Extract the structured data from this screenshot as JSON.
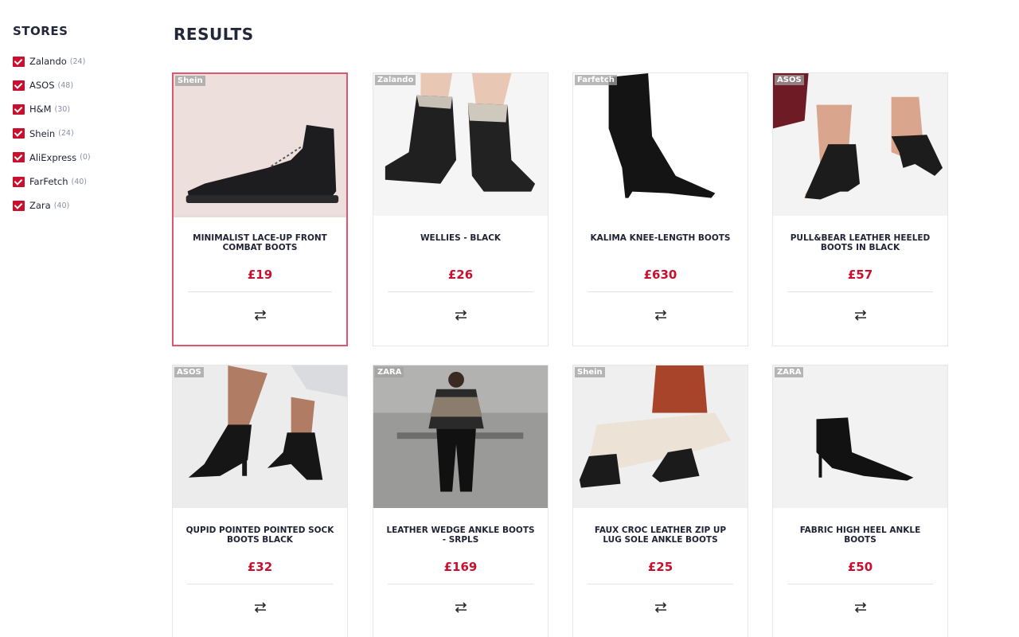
{
  "sidebar": {
    "title": "STORES",
    "stores": [
      {
        "name": "Zalando",
        "count": "(24)",
        "checked": true
      },
      {
        "name": "ASOS",
        "count": "(48)",
        "checked": true
      },
      {
        "name": "H&M",
        "count": "(30)",
        "checked": true
      },
      {
        "name": "Shein",
        "count": "(24)",
        "checked": true
      },
      {
        "name": "AliExpress",
        "count": "(0)",
        "checked": true
      },
      {
        "name": "FarFetch",
        "count": "(40)",
        "checked": true
      },
      {
        "name": "Zara",
        "count": "(40)",
        "checked": true
      }
    ]
  },
  "results": {
    "title": "RESULTS",
    "products": [
      {
        "store": "Shein",
        "title": "MINIMALIST LACE-UP FRONT COMBAT BOOTS",
        "price": "£19",
        "selected": true
      },
      {
        "store": "Zalando",
        "title": "WELLIES - BLACK",
        "price": "£26",
        "selected": false
      },
      {
        "store": "Farfetch",
        "title": "KALIMA KNEE-LENGTH BOOTS",
        "price": "£630",
        "selected": false
      },
      {
        "store": "ASOS",
        "title": "PULL&BEAR LEATHER HEELED BOOTS IN BLACK",
        "price": "£57",
        "selected": false
      },
      {
        "store": "ASOS",
        "title": "QUPID POINTED POINTED SOCK BOOTS BLACK",
        "price": "£32",
        "selected": false
      },
      {
        "store": "ZARA",
        "title": "LEATHER WEDGE ANKLE BOOTS - SRPLS",
        "price": "£169",
        "selected": false
      },
      {
        "store": "Shein",
        "title": "FAUX CROC LEATHER ZIP UP LUG SOLE ANKLE BOOTS",
        "price": "£25",
        "selected": false
      },
      {
        "store": "ZARA",
        "title": "FABRIC HIGH HEEL ANKLE BOOTS",
        "price": "£50",
        "selected": false
      }
    ]
  },
  "colors": {
    "accent": "#c8102e",
    "heading": "#24273a",
    "selected_border": "#e0566f"
  },
  "icons": {
    "checkbox": "checkmark-icon",
    "compare": "compare-arrows-icon"
  }
}
